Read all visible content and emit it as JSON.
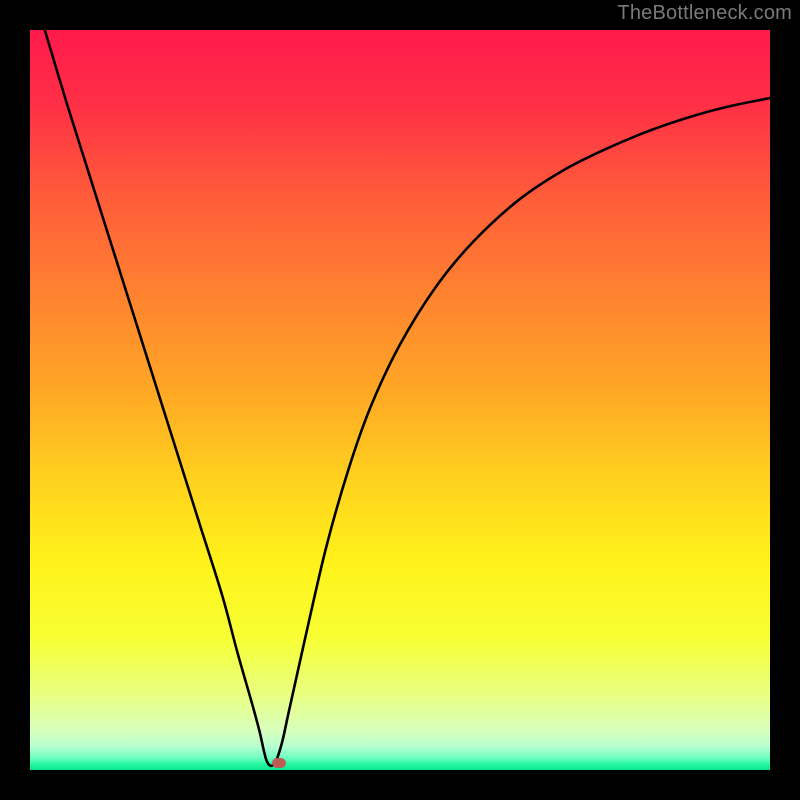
{
  "watermark": "TheBottleneck.com",
  "colors": {
    "frame_bg": "#000000",
    "watermark_text": "#7a7a7a",
    "curve_stroke": "#000000",
    "marker_fill": "#bb5d54",
    "gradient_stops": [
      {
        "offset": 0.0,
        "color": "#ff1a4b"
      },
      {
        "offset": 0.1,
        "color": "#ff2f46"
      },
      {
        "offset": 0.22,
        "color": "#ff5a3a"
      },
      {
        "offset": 0.35,
        "color": "#ff8030"
      },
      {
        "offset": 0.48,
        "color": "#ffa526"
      },
      {
        "offset": 0.6,
        "color": "#ffcf1e"
      },
      {
        "offset": 0.72,
        "color": "#fff21a"
      },
      {
        "offset": 0.82,
        "color": "#f7ff33"
      },
      {
        "offset": 0.9,
        "color": "#e8ff83"
      },
      {
        "offset": 0.945,
        "color": "#d9ffba"
      },
      {
        "offset": 0.968,
        "color": "#b7ffd1"
      },
      {
        "offset": 0.984,
        "color": "#6dffc1"
      },
      {
        "offset": 0.992,
        "color": "#24f8a3"
      },
      {
        "offset": 1.0,
        "color": "#0fe58f"
      }
    ]
  },
  "chart_data": {
    "type": "line",
    "title": "",
    "xlabel": "",
    "ylabel": "",
    "xlim": [
      0,
      100
    ],
    "ylim": [
      0,
      100
    ],
    "minimum_x": 32,
    "marker": {
      "x": 33.7,
      "y": 0.9
    },
    "series": [
      {
        "name": "bottleneck-curve",
        "x": [
          2,
          5,
          8,
          11,
          14,
          17,
          20,
          23,
          26,
          28,
          30,
          31,
          32,
          33,
          34,
          35,
          37,
          40,
          43,
          46,
          50,
          55,
          60,
          66,
          72,
          78,
          84,
          90,
          95,
          100
        ],
        "y": [
          100,
          90,
          80.5,
          71,
          61.5,
          52,
          42.5,
          33,
          23.5,
          16,
          9,
          5.3,
          1.2,
          0.8,
          3.5,
          8,
          17,
          30,
          40.5,
          49,
          57.5,
          65.5,
          71.5,
          77,
          81,
          84,
          86.5,
          88.5,
          89.8,
          90.8
        ]
      }
    ]
  }
}
